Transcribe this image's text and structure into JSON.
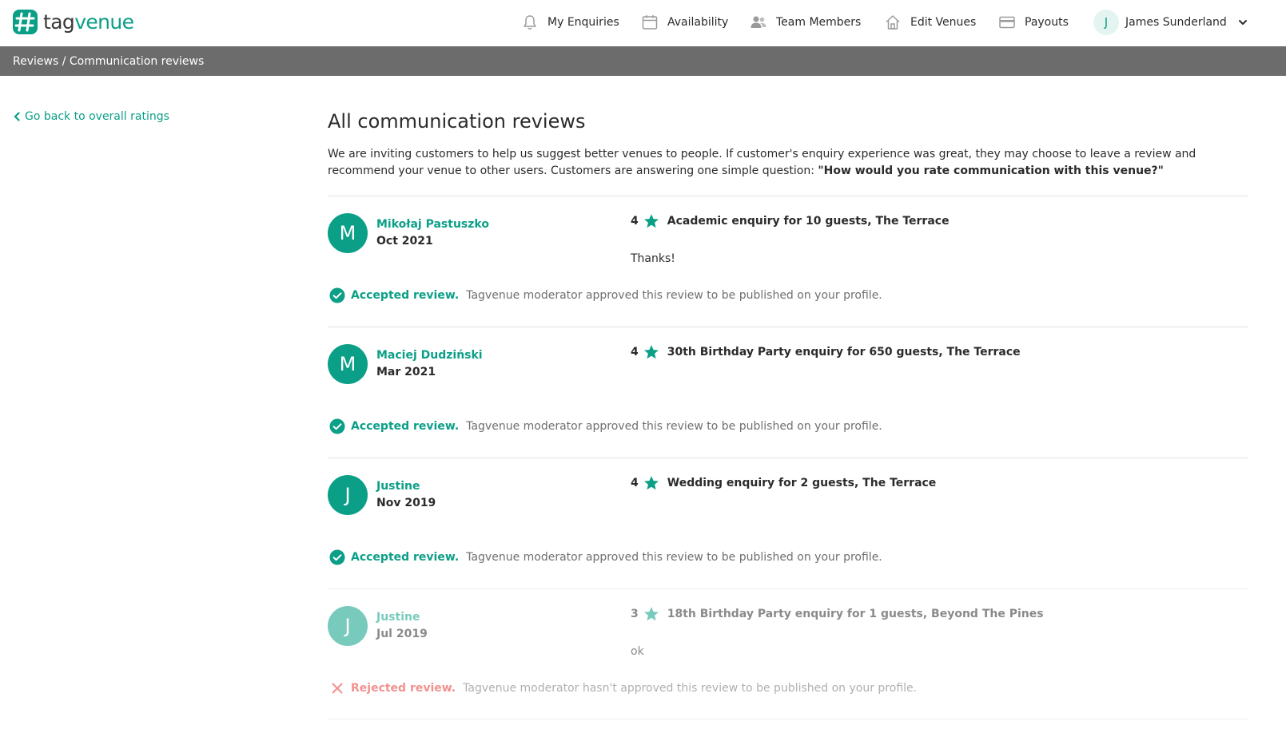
{
  "brand": {
    "logo_prefix": "tag",
    "logo_suffix": "venue",
    "accent_color": "#0b9f87"
  },
  "nav": {
    "enquiries": {
      "label": "My Enquiries",
      "icon": "bell-icon"
    },
    "availability": {
      "label": "Availability",
      "icon": "calendar-icon"
    },
    "team": {
      "label": "Team Members",
      "icon": "users-icon"
    },
    "venues": {
      "label": "Edit Venues",
      "icon": "home-icon"
    },
    "payouts": {
      "label": "Payouts",
      "icon": "credit-card-icon"
    },
    "user": {
      "initial": "J",
      "name": "James Sunderland"
    }
  },
  "breadcrumb": "Reviews / Communication reviews",
  "back_link": "Go back to overall ratings",
  "page": {
    "title": "All communication reviews",
    "intro": "We are inviting customers to help us suggest better venues to people. If customer's enquiry experience was great, they may choose to leave a review and recommend your venue to other users. Customers are answering one simple question: ",
    "question": "\"How would you rate communication with this venue?\""
  },
  "status_text": {
    "accepted_label": "Accepted review.",
    "accepted_desc": "Tagvenue moderator approved this review to be published on your profile.",
    "rejected_label": "Rejected review.",
    "rejected_desc": "Tagvenue moderator hasn't approved this review to be published on your profile."
  },
  "reviews": [
    {
      "initial": "M",
      "name": "Mikołaj Pastuszko",
      "date": "Oct 2021",
      "rating": "4",
      "enquiry": "Academic enquiry for 10 guests, The Terrace",
      "comment": "Thanks!",
      "status": "accepted"
    },
    {
      "initial": "M",
      "name": "Maciej Dudziński",
      "date": "Mar 2021",
      "rating": "4",
      "enquiry": "30th Birthday Party enquiry for 650 guests, The Terrace",
      "comment": "",
      "status": "accepted"
    },
    {
      "initial": "J",
      "name": "Justine",
      "date": "Nov 2019",
      "rating": "4",
      "enquiry": "Wedding enquiry for 2 guests, The Terrace",
      "comment": "",
      "status": "accepted"
    },
    {
      "initial": "J",
      "name": "Justine",
      "date": "Jul 2019",
      "rating": "3",
      "enquiry": "18th Birthday Party enquiry for 1 guests, Beyond The Pines",
      "comment": "ok",
      "status": "rejected"
    }
  ]
}
